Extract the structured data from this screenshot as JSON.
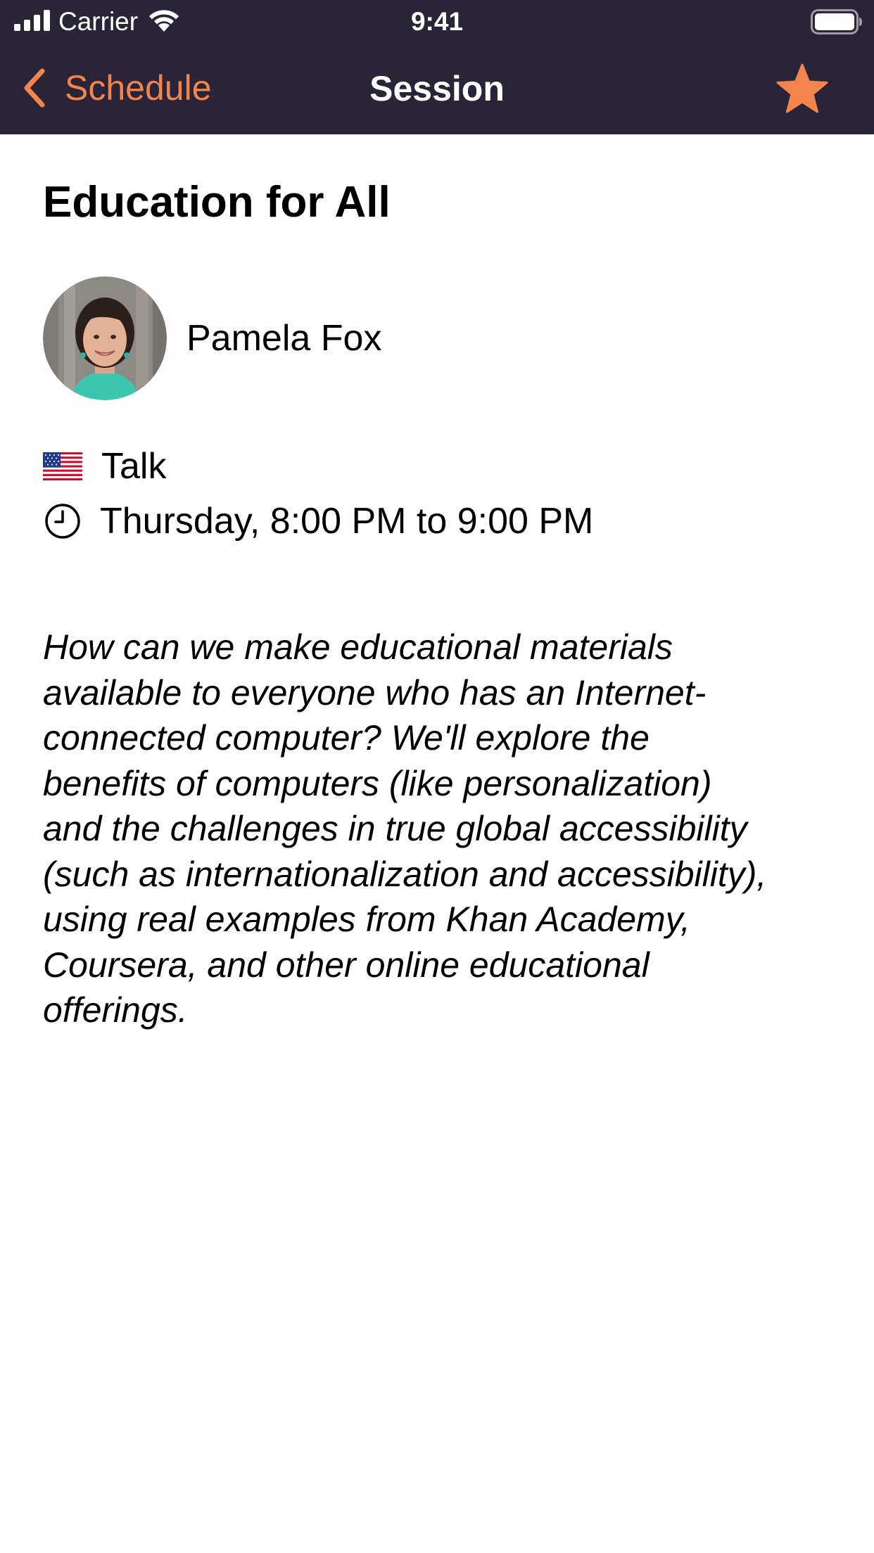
{
  "status_bar": {
    "carrier": "Carrier",
    "time": "9:41"
  },
  "nav": {
    "back_label": "Schedule",
    "title": "Session",
    "favorite_icon": "star-icon",
    "favorited": true
  },
  "session": {
    "title": "Education for All",
    "speaker": {
      "name": "Pamela Fox",
      "avatar": "speaker-photo"
    },
    "type": {
      "icon": "us-flag-icon",
      "label": "Talk"
    },
    "time": {
      "icon": "clock-icon",
      "label": "Thursday, 8:00 PM to 9:00 PM"
    },
    "description_lines": [
      "How can we make educational materials",
      "available to everyone who has an Internet-",
      "connected computer? We'll explore the",
      "benefits of computers (like personalization)",
      "and the challenges in true global accessibility",
      "(such as internationalization and accessibility),",
      "using real examples from Khan Academy,",
      "Coursera, and other online educational",
      "offerings."
    ]
  },
  "colors": {
    "header_bg": "#2a2438",
    "accent": "#f2844c",
    "header_text": "#ffffff",
    "body_bg": "#ffffff",
    "body_text": "#000000"
  }
}
